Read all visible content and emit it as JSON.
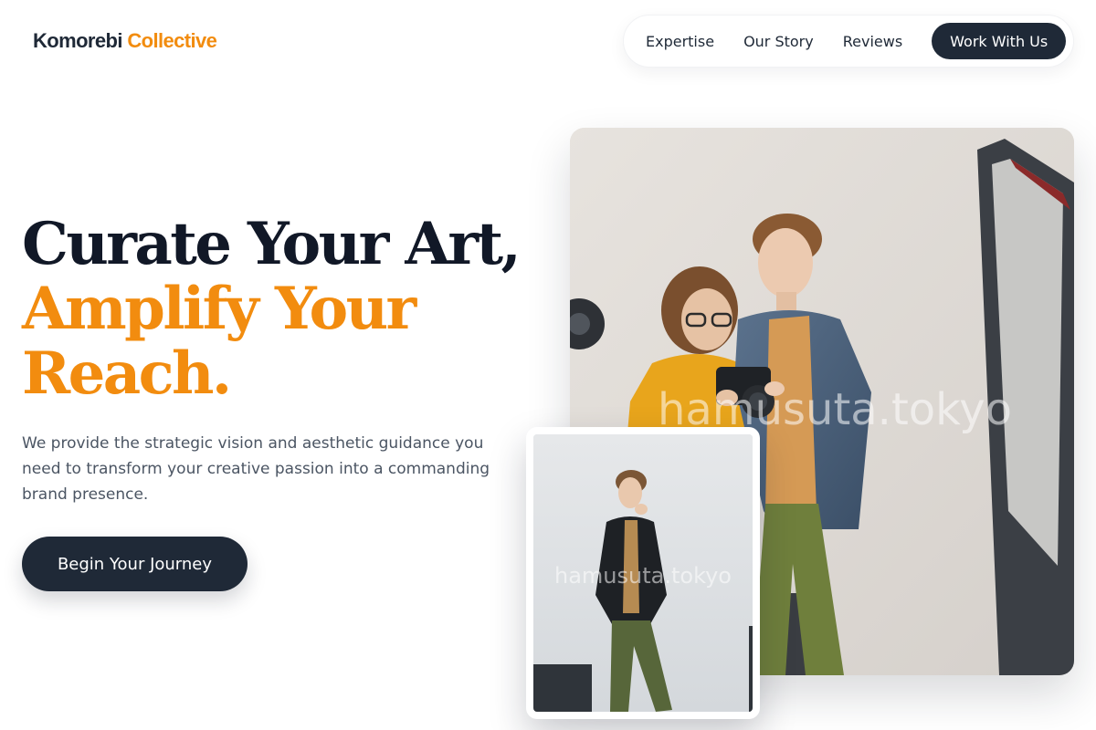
{
  "brand": {
    "name_primary": "Komorebi",
    "name_accent": "Collective"
  },
  "nav": {
    "links": [
      "Expertise",
      "Our Story",
      "Reviews"
    ],
    "cta_label": "Work With Us"
  },
  "hero": {
    "headline_line1": "Curate Your Art,",
    "headline_line2": "Amplify Your",
    "headline_line3": "Reach.",
    "lead": "We provide the strategic vision and aesthetic guidance you need to transform your creative passion into a commanding brand presence.",
    "cta_label": "Begin Your Journey"
  },
  "images": {
    "main_watermark": "hamusuta.tokyo",
    "small_watermark": "hamusuta.tokyo"
  },
  "colors": {
    "accent": "#f28c0f",
    "dark": "#1f2937",
    "headline": "#111827",
    "body_text": "#4b5563"
  }
}
